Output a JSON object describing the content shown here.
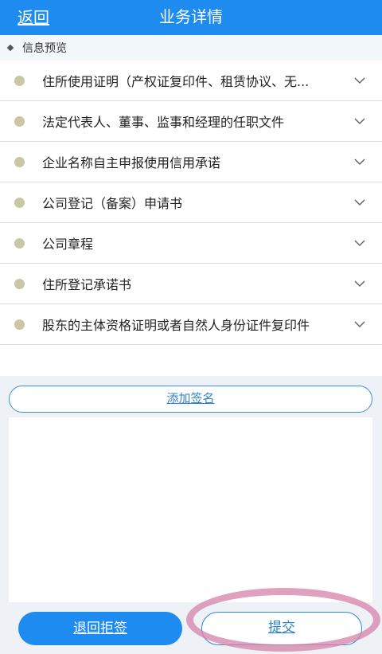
{
  "header": {
    "back_label": "返回",
    "title": "业务详情",
    "background_color": "#1e8bf0"
  },
  "section": {
    "title": "信息预览"
  },
  "documents": [
    {
      "label": "住所使用证明（产权证复印件、租赁协议、无..."
    },
    {
      "label": "法定代表人、董事、监事和经理的任职文件"
    },
    {
      "label": "企业名称自主申报使用信用承诺"
    },
    {
      "label": "公司登记（备案）申请书"
    },
    {
      "label": "公司章程"
    },
    {
      "label": "住所登记承诺书"
    },
    {
      "label": "股东的主体资格证明或者自然人身份证件复印件"
    }
  ],
  "signature": {
    "add_label": "添加签名"
  },
  "actions": {
    "reject_label": "退回拒签",
    "submit_label": "提交"
  },
  "icons": {
    "row_status": "dot-icon",
    "row_expand": "chevron-down-icon",
    "section_marker": "diamond-icon"
  },
  "colors": {
    "accent": "#1e8bf0",
    "status_dot": "#c9c7a4",
    "highlight": "#d682aa"
  }
}
